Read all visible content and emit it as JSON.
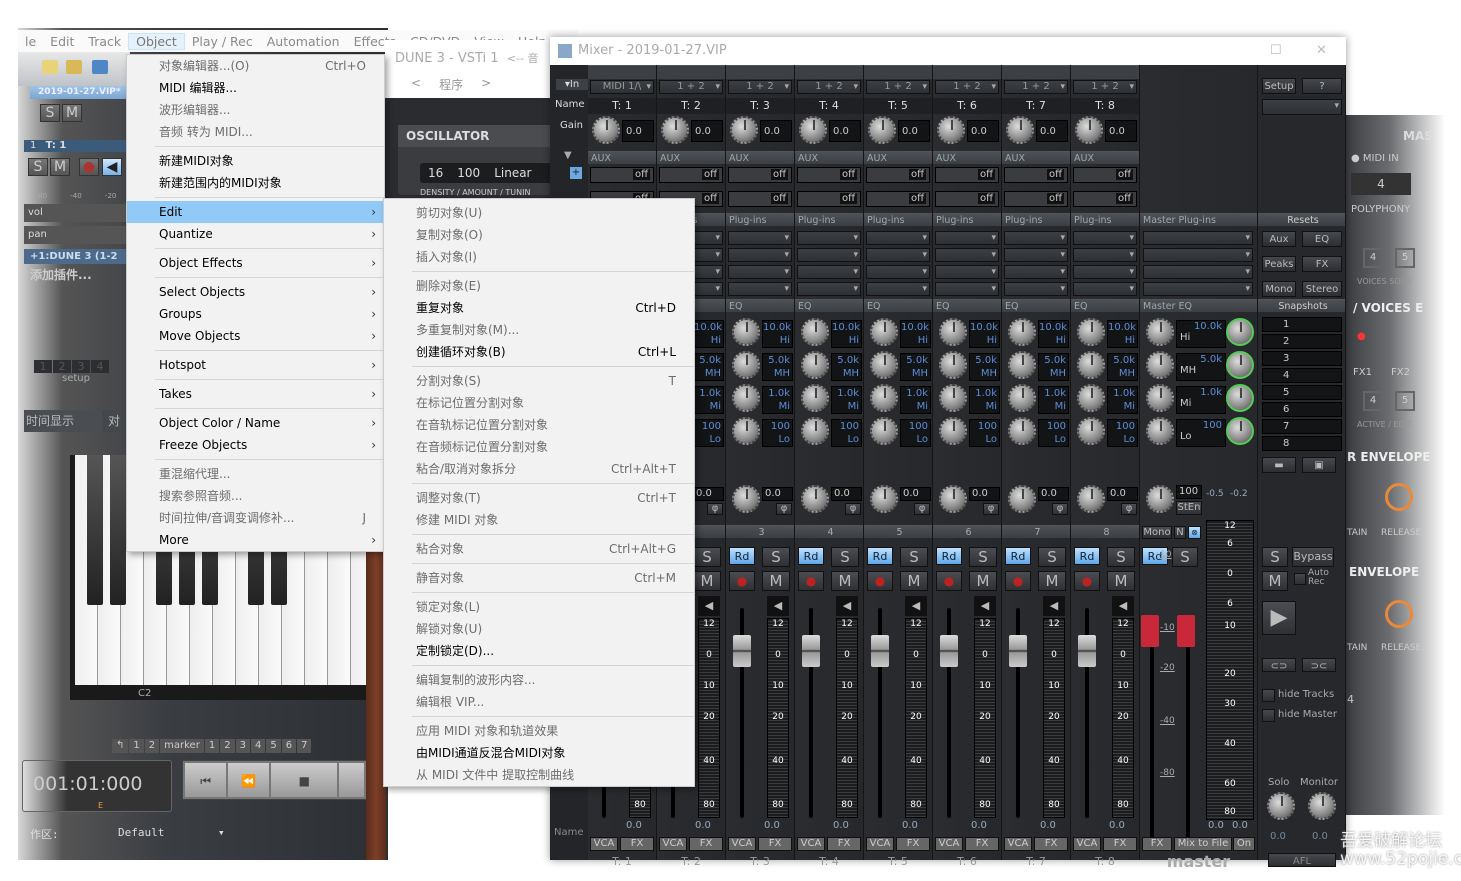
{
  "app": {
    "menubar": [
      "le",
      "Edit",
      "Track",
      "Object",
      "Play / Rec",
      "Automation",
      "Effects",
      "CD/DVD",
      "View",
      "Help"
    ],
    "active_menu_index": 3,
    "project_tab": "2019-01-27.VIP*",
    "top_buttons": [
      "S",
      "M"
    ],
    "track": {
      "number": "1",
      "name": "T: 1",
      "solo": "S",
      "mute": "M",
      "meter_ticks": [
        "-80",
        "-40",
        "-20"
      ],
      "vol_label": "vol",
      "pan_label": "pan",
      "plugin": "+1:DUNE 3 (1-2",
      "add_plugin": "添加插件...",
      "setup_slots": [
        "1",
        "2",
        "3",
        "4"
      ],
      "setup_label": "setup",
      "time_display_tab": "时间显示",
      "align_tab": "对"
    },
    "keyboard_label": "C2",
    "marker_bar": [
      "↰",
      "1",
      "2",
      "marker",
      "1",
      "2",
      "3",
      "4",
      "5",
      "6",
      "7"
    ],
    "time_display": "001:01:000",
    "time_sub": "E",
    "workspace_label": "作区:",
    "workspace_value": "Default"
  },
  "plugin": {
    "title": "DUNE 3 - VSTi 1",
    "title_suffix": "<-- 音",
    "nav": [
      "<",
      "程序",
      ">"
    ],
    "oscillator": "OSCILLATOR",
    "osc_values": [
      "16",
      "100",
      "Linear"
    ],
    "osc_caption": "DENSITY / AMOUNT / TUNIN",
    "right": {
      "master": "MAS",
      "midi_in": "MIDI IN",
      "polyphony_value": "4",
      "polyphony": "POLYPHONY",
      "voices_solo_buttons": [
        "4",
        "5"
      ],
      "voices_solo": "VOICES SOLO",
      "voices_edit": "/ VOICES E",
      "fx1": "FX1",
      "fx2": "FX2",
      "active_buttons": [
        "4",
        "5"
      ],
      "active_edit": "ACTIVE / EDIT",
      "envelope1": "R ENVELOPE",
      "sustain1": "TAIN",
      "release1": "RELEASE",
      "envelope2": "ENVELOPE",
      "sustain2": "TAIN",
      "release2": "RELEASE",
      "value": "4"
    }
  },
  "mixer": {
    "title": "Mixer - 2019-01-27.VIP",
    "row_labels": {
      "in": "▾In",
      "name": "Name",
      "gain": "Gain",
      "name_bottom": "Name"
    },
    "aux_label": "AUX",
    "plugins_label": "Plug-ins",
    "eq_label": "EQ",
    "send_state": "off",
    "channels": [
      {
        "input": "MIDI 1/\\",
        "name": "T: 1",
        "gain": "0.0",
        "num": "1"
      },
      {
        "input": "1 + 2",
        "name": "T: 2",
        "gain": "0.0",
        "num": "2"
      },
      {
        "input": "1 + 2",
        "name": "T: 3",
        "gain": "0.0",
        "num": "3"
      },
      {
        "input": "1 + 2",
        "name": "T: 4",
        "gain": "0.0",
        "num": "4"
      },
      {
        "input": "1 + 2",
        "name": "T: 5",
        "gain": "0.0",
        "num": "5"
      },
      {
        "input": "1 + 2",
        "name": "T: 6",
        "gain": "0.0",
        "num": "6"
      },
      {
        "input": "1 + 2",
        "name": "T: 7",
        "gain": "0.0",
        "num": "7"
      },
      {
        "input": "1 + 2",
        "name": "T: 8",
        "gain": "0.0",
        "num": "8"
      }
    ],
    "eq_bands": [
      {
        "freq": "10.0k",
        "band": "Hi"
      },
      {
        "freq": "5.0k",
        "band": "MH"
      },
      {
        "freq": "1.0k",
        "band": "Mi"
      },
      {
        "freq": "100",
        "band": "Lo"
      }
    ],
    "pan_value": "0.0",
    "phase": "φ",
    "strip_buttons": {
      "read": "Rd",
      "solo": "S",
      "mute": "M"
    },
    "meter_scale": [
      "12",
      "0",
      "10",
      "20",
      "40",
      "80"
    ],
    "level_value": "0.0",
    "vca": "VCA",
    "fx": "FX",
    "master": {
      "plugins_label": "Master Plug-ins",
      "eq_label": "Master EQ",
      "width_value": "100",
      "width_button": "StEn",
      "peak_l": "-0.5",
      "peak_r": "-0.2",
      "mono": "Mono",
      "n": "N",
      "fader_scale": [
        "10",
        "-10",
        "-20",
        "-40",
        "-80"
      ],
      "meter_scale": [
        "12",
        "6",
        "0",
        "6",
        "10",
        "20",
        "30",
        "40",
        "60",
        "80"
      ],
      "level_l": "0.0",
      "level_r": "0.0",
      "fx": "FX",
      "mix_to_file": "Mix to File",
      "on": "On",
      "name": "master",
      "accent_fader": "#c8283a"
    },
    "right": {
      "setup": "Setup",
      "help": "?",
      "resets": "Resets",
      "reset_buttons": [
        "Aux",
        "EQ",
        "Peaks",
        "FX",
        "Mono",
        "Stereo"
      ],
      "snapshots": "Snapshots",
      "snapshot_slots": [
        "1",
        "2",
        "3",
        "4",
        "5",
        "6",
        "7",
        "8"
      ],
      "solo": "S",
      "bypass": "Bypass",
      "mute": "M",
      "auto_rec": "Auto Rec",
      "hide_tracks": "hide Tracks",
      "hide_master": "hide Master",
      "solo_knob": "Solo",
      "monitor_knob": "Monitor",
      "solo_value": "0.0",
      "monitor_value": "0.0",
      "afl": "AFL"
    }
  },
  "object_menu": [
    {
      "label": "对象编辑器...(O)",
      "shortcut": "Ctrl+O",
      "disabled": true
    },
    {
      "label": "MIDI 编辑器..."
    },
    {
      "label": "波形编辑器...",
      "disabled": true
    },
    {
      "label": "音频 转为 MIDI...",
      "disabled": true
    },
    {
      "sep": true
    },
    {
      "label": "新建MIDI对象"
    },
    {
      "label": "新建范围内的MIDI对象"
    },
    {
      "sep": true
    },
    {
      "label": "Edit",
      "submenu": true,
      "highlighted": true
    },
    {
      "label": "Quantize",
      "submenu": true
    },
    {
      "sep": true
    },
    {
      "label": "Object Effects",
      "submenu": true
    },
    {
      "sep": true
    },
    {
      "label": "Select Objects",
      "submenu": true
    },
    {
      "label": "Groups",
      "submenu": true
    },
    {
      "label": "Move Objects",
      "submenu": true
    },
    {
      "sep": true
    },
    {
      "label": "Hotspot",
      "submenu": true
    },
    {
      "sep": true
    },
    {
      "label": "Takes",
      "submenu": true
    },
    {
      "sep": true
    },
    {
      "label": "Object Color / Name",
      "submenu": true
    },
    {
      "label": "Freeze Objects",
      "submenu": true
    },
    {
      "sep": true
    },
    {
      "label": "重混缩代理...",
      "disabled": true
    },
    {
      "label": "搜索参照音频...",
      "disabled": true
    },
    {
      "label": "时间拉伸/音调变调修补...",
      "shortcut": "J",
      "disabled": true
    },
    {
      "label": "More",
      "submenu": true
    }
  ],
  "edit_submenu": [
    {
      "label": "剪切对象(U)",
      "disabled": true
    },
    {
      "label": "复制对象(O)",
      "disabled": true
    },
    {
      "label": "插入对象(I)",
      "disabled": true
    },
    {
      "sep": true
    },
    {
      "label": "删除对象(E)",
      "disabled": true
    },
    {
      "label": "重复对象",
      "shortcut": "Ctrl+D"
    },
    {
      "label": "多重复制对象(M)...",
      "disabled": true
    },
    {
      "label": "创建循环对象(B)",
      "shortcut": "Ctrl+L"
    },
    {
      "sep": true
    },
    {
      "label": "分割对象(S)",
      "shortcut": "T",
      "disabled": true
    },
    {
      "label": "在标记位置分割对象",
      "disabled": true
    },
    {
      "label": "在音轨标记位置分割对象",
      "disabled": true
    },
    {
      "label": "在音频标记位置分割对象",
      "disabled": true
    },
    {
      "label": "粘合/取消对象拆分",
      "shortcut": "Ctrl+Alt+T",
      "disabled": true
    },
    {
      "sep": true
    },
    {
      "label": "调整对象(T)",
      "shortcut": "Ctrl+T",
      "disabled": true
    },
    {
      "label": "修建 MIDI 对象",
      "disabled": true
    },
    {
      "sep": true
    },
    {
      "label": "粘合对象",
      "shortcut": "Ctrl+Alt+G",
      "disabled": true
    },
    {
      "sep": true
    },
    {
      "label": "静音对象",
      "shortcut": "Ctrl+M",
      "disabled": true
    },
    {
      "sep": true
    },
    {
      "label": "锁定对象(L)",
      "disabled": true
    },
    {
      "label": "解锁对象(U)",
      "disabled": true
    },
    {
      "label": "定制锁定(D)..."
    },
    {
      "sep": true
    },
    {
      "label": "编辑复制的波形内容...",
      "disabled": true
    },
    {
      "label": "编辑根 VIP...",
      "disabled": true
    },
    {
      "sep": true
    },
    {
      "label": "应用 MIDI 对象和轨道效果",
      "disabled": true
    },
    {
      "label": "由MIDI通道反混合MIDI对象"
    },
    {
      "label": "从 MIDI 文件中 提取控制曲线",
      "disabled": true
    }
  ],
  "watermark": "吾爱破解论坛 www.52pojie.cn"
}
